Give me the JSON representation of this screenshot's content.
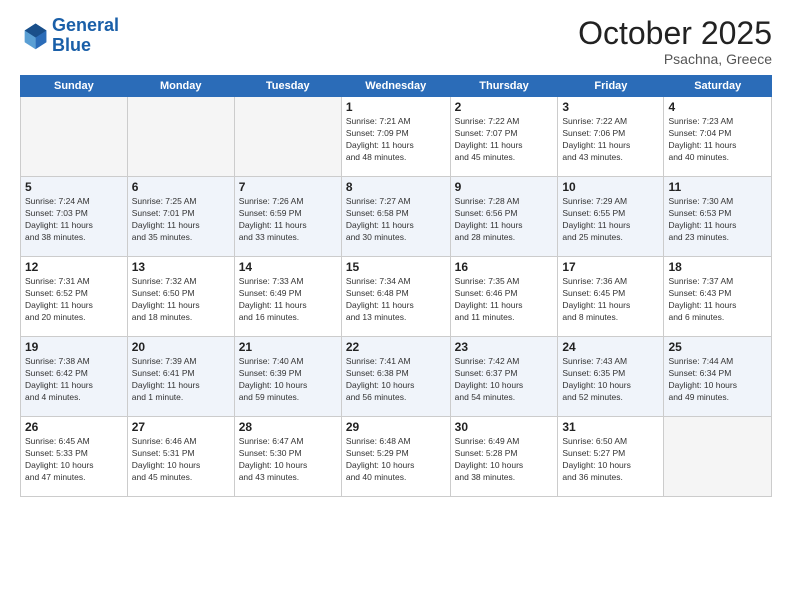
{
  "header": {
    "logo_general": "General",
    "logo_blue": "Blue",
    "month": "October 2025",
    "location": "Psachna, Greece"
  },
  "days_of_week": [
    "Sunday",
    "Monday",
    "Tuesday",
    "Wednesday",
    "Thursday",
    "Friday",
    "Saturday"
  ],
  "weeks": [
    {
      "alt": false,
      "days": [
        {
          "num": "",
          "info": ""
        },
        {
          "num": "",
          "info": ""
        },
        {
          "num": "",
          "info": ""
        },
        {
          "num": "1",
          "info": "Sunrise: 7:21 AM\nSunset: 7:09 PM\nDaylight: 11 hours\nand 48 minutes."
        },
        {
          "num": "2",
          "info": "Sunrise: 7:22 AM\nSunset: 7:07 PM\nDaylight: 11 hours\nand 45 minutes."
        },
        {
          "num": "3",
          "info": "Sunrise: 7:22 AM\nSunset: 7:06 PM\nDaylight: 11 hours\nand 43 minutes."
        },
        {
          "num": "4",
          "info": "Sunrise: 7:23 AM\nSunset: 7:04 PM\nDaylight: 11 hours\nand 40 minutes."
        }
      ]
    },
    {
      "alt": true,
      "days": [
        {
          "num": "5",
          "info": "Sunrise: 7:24 AM\nSunset: 7:03 PM\nDaylight: 11 hours\nand 38 minutes."
        },
        {
          "num": "6",
          "info": "Sunrise: 7:25 AM\nSunset: 7:01 PM\nDaylight: 11 hours\nand 35 minutes."
        },
        {
          "num": "7",
          "info": "Sunrise: 7:26 AM\nSunset: 6:59 PM\nDaylight: 11 hours\nand 33 minutes."
        },
        {
          "num": "8",
          "info": "Sunrise: 7:27 AM\nSunset: 6:58 PM\nDaylight: 11 hours\nand 30 minutes."
        },
        {
          "num": "9",
          "info": "Sunrise: 7:28 AM\nSunset: 6:56 PM\nDaylight: 11 hours\nand 28 minutes."
        },
        {
          "num": "10",
          "info": "Sunrise: 7:29 AM\nSunset: 6:55 PM\nDaylight: 11 hours\nand 25 minutes."
        },
        {
          "num": "11",
          "info": "Sunrise: 7:30 AM\nSunset: 6:53 PM\nDaylight: 11 hours\nand 23 minutes."
        }
      ]
    },
    {
      "alt": false,
      "days": [
        {
          "num": "12",
          "info": "Sunrise: 7:31 AM\nSunset: 6:52 PM\nDaylight: 11 hours\nand 20 minutes."
        },
        {
          "num": "13",
          "info": "Sunrise: 7:32 AM\nSunset: 6:50 PM\nDaylight: 11 hours\nand 18 minutes."
        },
        {
          "num": "14",
          "info": "Sunrise: 7:33 AM\nSunset: 6:49 PM\nDaylight: 11 hours\nand 16 minutes."
        },
        {
          "num": "15",
          "info": "Sunrise: 7:34 AM\nSunset: 6:48 PM\nDaylight: 11 hours\nand 13 minutes."
        },
        {
          "num": "16",
          "info": "Sunrise: 7:35 AM\nSunset: 6:46 PM\nDaylight: 11 hours\nand 11 minutes."
        },
        {
          "num": "17",
          "info": "Sunrise: 7:36 AM\nSunset: 6:45 PM\nDaylight: 11 hours\nand 8 minutes."
        },
        {
          "num": "18",
          "info": "Sunrise: 7:37 AM\nSunset: 6:43 PM\nDaylight: 11 hours\nand 6 minutes."
        }
      ]
    },
    {
      "alt": true,
      "days": [
        {
          "num": "19",
          "info": "Sunrise: 7:38 AM\nSunset: 6:42 PM\nDaylight: 11 hours\nand 4 minutes."
        },
        {
          "num": "20",
          "info": "Sunrise: 7:39 AM\nSunset: 6:41 PM\nDaylight: 11 hours\nand 1 minute."
        },
        {
          "num": "21",
          "info": "Sunrise: 7:40 AM\nSunset: 6:39 PM\nDaylight: 10 hours\nand 59 minutes."
        },
        {
          "num": "22",
          "info": "Sunrise: 7:41 AM\nSunset: 6:38 PM\nDaylight: 10 hours\nand 56 minutes."
        },
        {
          "num": "23",
          "info": "Sunrise: 7:42 AM\nSunset: 6:37 PM\nDaylight: 10 hours\nand 54 minutes."
        },
        {
          "num": "24",
          "info": "Sunrise: 7:43 AM\nSunset: 6:35 PM\nDaylight: 10 hours\nand 52 minutes."
        },
        {
          "num": "25",
          "info": "Sunrise: 7:44 AM\nSunset: 6:34 PM\nDaylight: 10 hours\nand 49 minutes."
        }
      ]
    },
    {
      "alt": false,
      "days": [
        {
          "num": "26",
          "info": "Sunrise: 6:45 AM\nSunset: 5:33 PM\nDaylight: 10 hours\nand 47 minutes."
        },
        {
          "num": "27",
          "info": "Sunrise: 6:46 AM\nSunset: 5:31 PM\nDaylight: 10 hours\nand 45 minutes."
        },
        {
          "num": "28",
          "info": "Sunrise: 6:47 AM\nSunset: 5:30 PM\nDaylight: 10 hours\nand 43 minutes."
        },
        {
          "num": "29",
          "info": "Sunrise: 6:48 AM\nSunset: 5:29 PM\nDaylight: 10 hours\nand 40 minutes."
        },
        {
          "num": "30",
          "info": "Sunrise: 6:49 AM\nSunset: 5:28 PM\nDaylight: 10 hours\nand 38 minutes."
        },
        {
          "num": "31",
          "info": "Sunrise: 6:50 AM\nSunset: 5:27 PM\nDaylight: 10 hours\nand 36 minutes."
        },
        {
          "num": "",
          "info": ""
        }
      ]
    }
  ]
}
